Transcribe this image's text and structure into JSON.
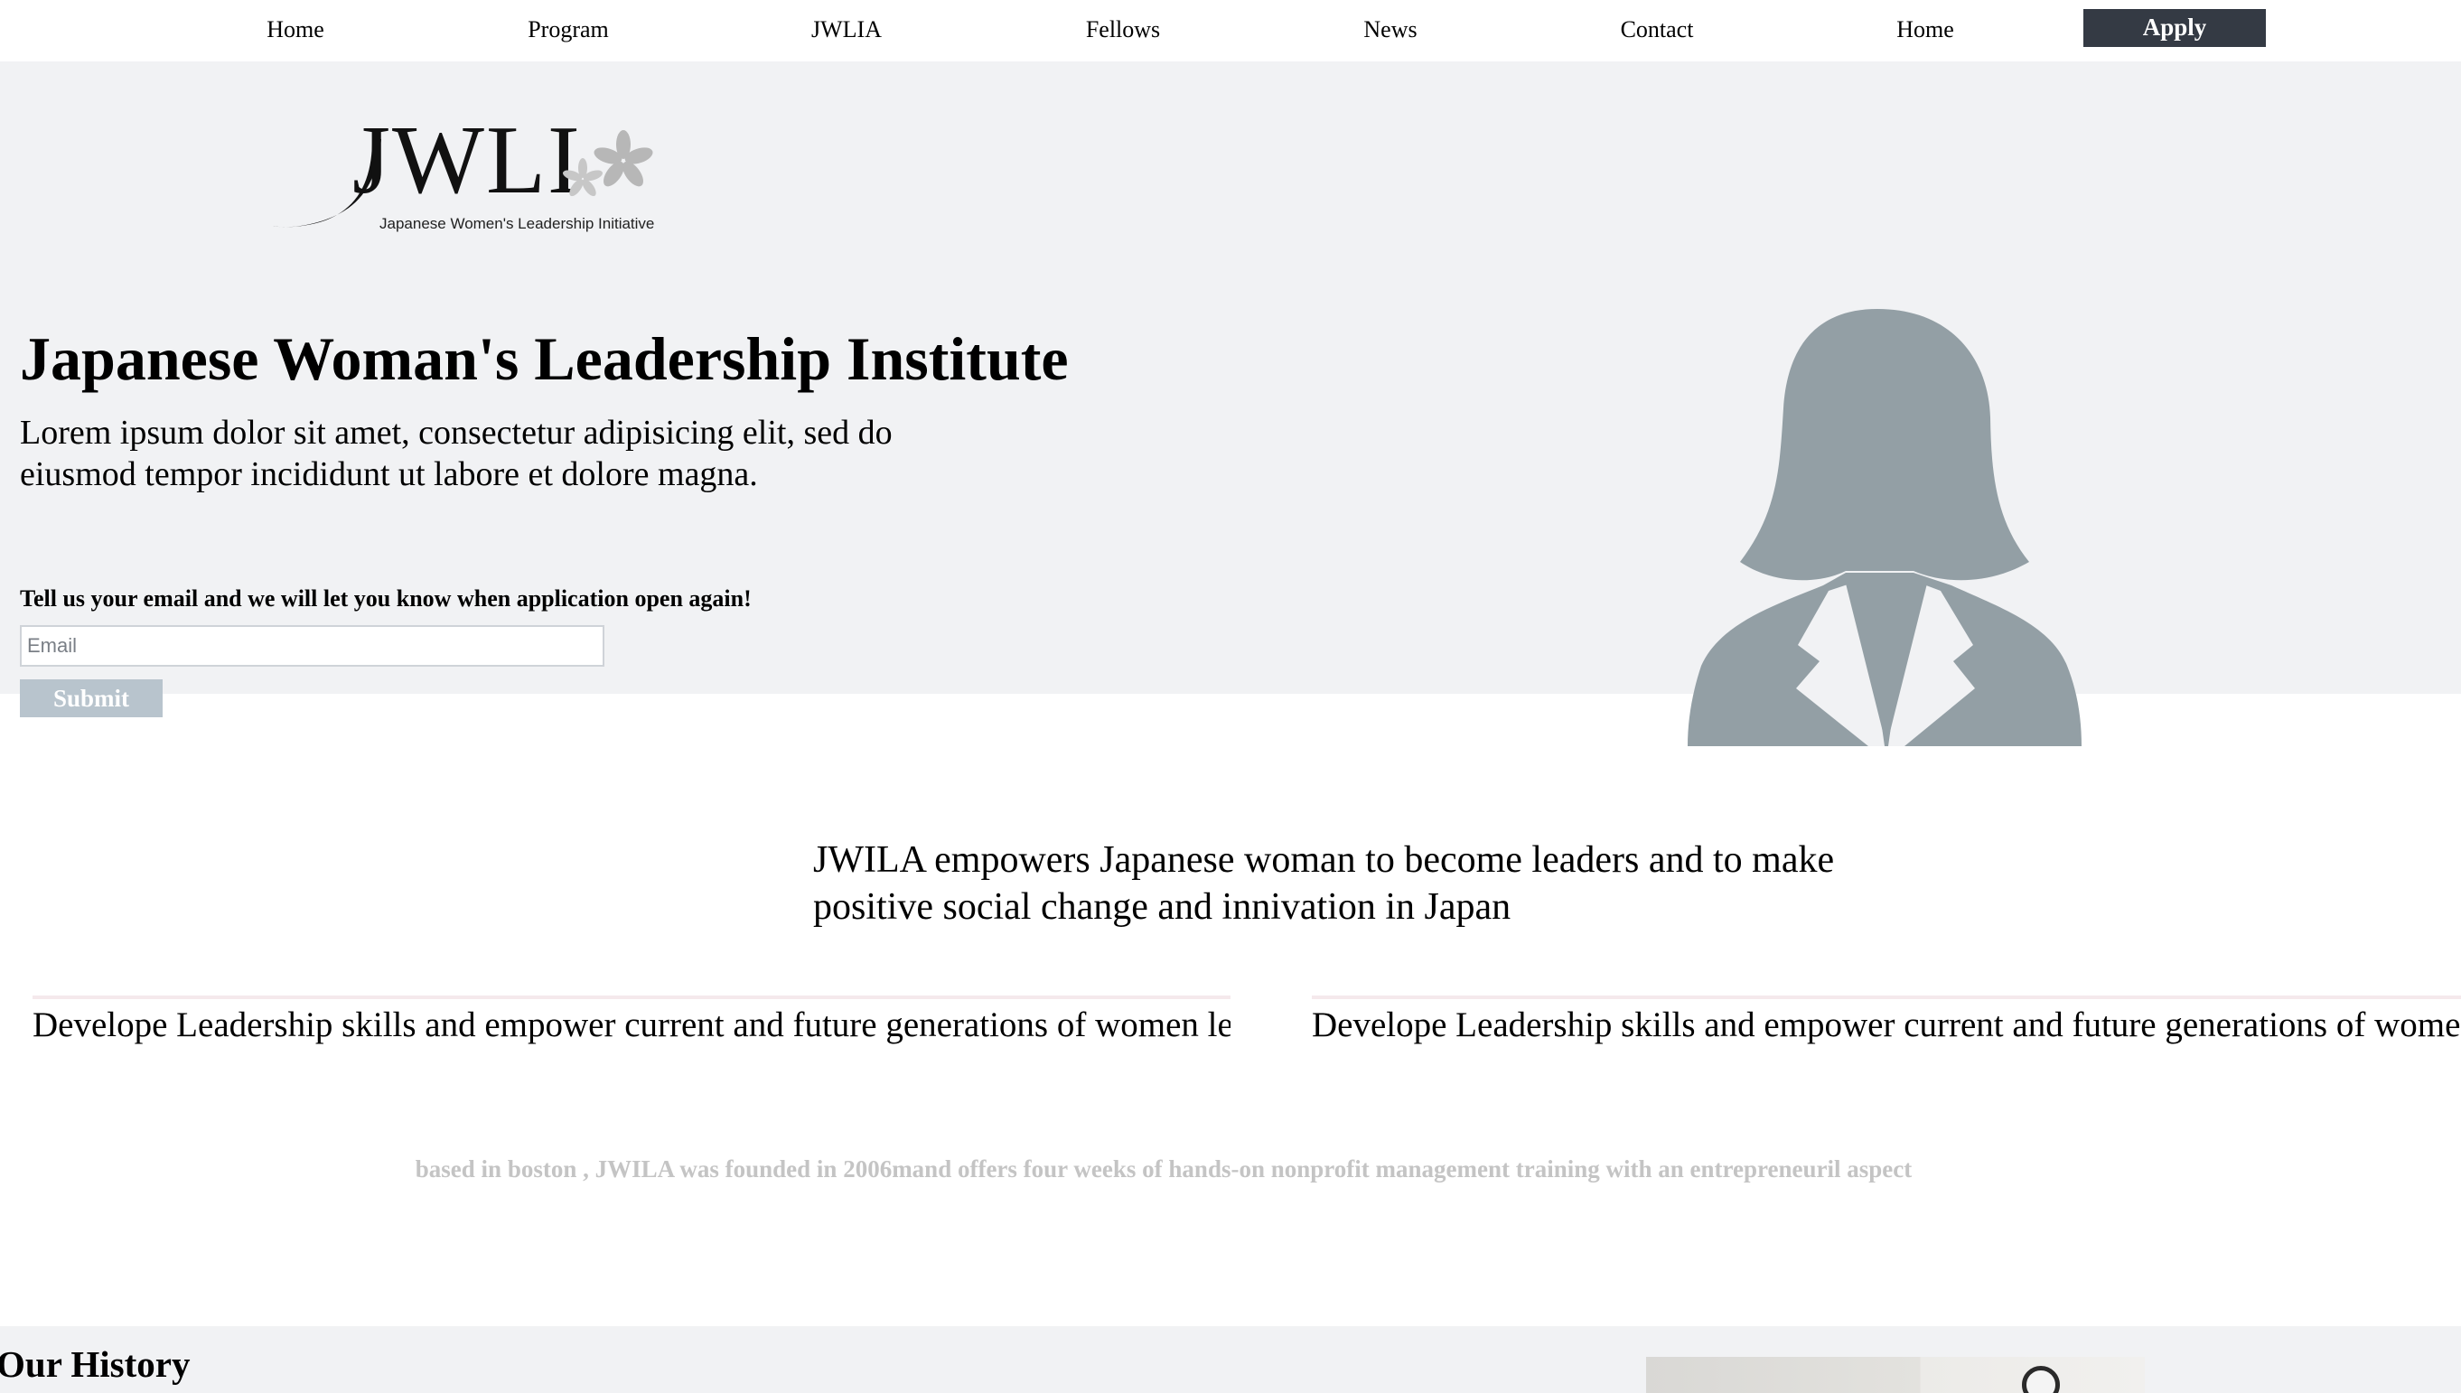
{
  "nav": {
    "items": [
      "Home",
      "Program",
      "JWLIA",
      "Fellows",
      "News",
      "Contact",
      "Home"
    ],
    "apply_label": "Apply"
  },
  "logo": {
    "wordmark": "JWLI",
    "tagline": "Japanese Women's Leadership Initiative",
    "icon": "cherry-blossom-icon"
  },
  "hero": {
    "title": "Japanese Woman's Leadership Institute",
    "lead": "Lorem ipsum dolor sit amet, consectetur adipisicing elit, sed do eiusmod tempor incididunt ut labore et dolore magna.",
    "email_prompt": "Tell us your email and we will let you know when application open again!",
    "email_placeholder": "Email",
    "submit_label": "Submit",
    "avatar_icon": "woman-silhouette-icon"
  },
  "mission": {
    "statement": "JWILA empowers Japanese woman to become leaders and to make positive social change and innivation in Japan",
    "columns": [
      "Develope Leadership skills and empower current and future generations of women leaders in Japan.",
      "Develope Leadership skills and empower current and future generations of women leaders in Japan."
    ],
    "founded": "based in boston , JWILA was founded in 2006mand offers four weeks of hands-on nonprofit management training with an entrepreneuril aspect"
  },
  "history": {
    "title": "Our History"
  },
  "colors": {
    "hero_bg": "#f1f2f4",
    "apply_bg": "#343a44",
    "submit_bg": "#b8c4cd",
    "avatar": "#939fa5",
    "muted_text": "#c4c4c4"
  }
}
